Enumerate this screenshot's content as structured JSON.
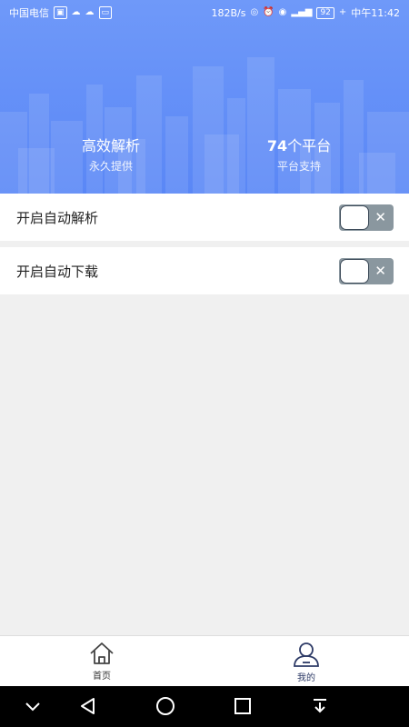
{
  "status_bar": {
    "carrier": "中国电信",
    "speed": "182B/s",
    "battery": "92",
    "time": "中午11:42"
  },
  "hero": {
    "stat_left": {
      "title": "高效解析",
      "subtitle": "永久提供"
    },
    "stat_right": {
      "title_number": "74",
      "title_text": "个平台",
      "subtitle": "平台支持"
    }
  },
  "settings": [
    {
      "label": "开启自动解析",
      "enabled": false,
      "toggle_icon": "close-icon"
    },
    {
      "label": "开启自动下载",
      "enabled": false,
      "toggle_icon": "close-icon"
    }
  ],
  "tabbar": {
    "tabs": [
      {
        "label": "首页",
        "icon": "home-icon"
      },
      {
        "label": "我的",
        "icon": "user-icon",
        "active": true
      }
    ]
  },
  "navbar": {
    "buttons": [
      "chevron-down-icon",
      "back-icon",
      "home-circle-icon",
      "recents-icon",
      "download-icon"
    ]
  },
  "colors": {
    "hero_top": "#6f99f9",
    "hero_bottom": "#5a87f6",
    "toggle_track": "#8a979f",
    "active_tab": "#2d3a66"
  }
}
